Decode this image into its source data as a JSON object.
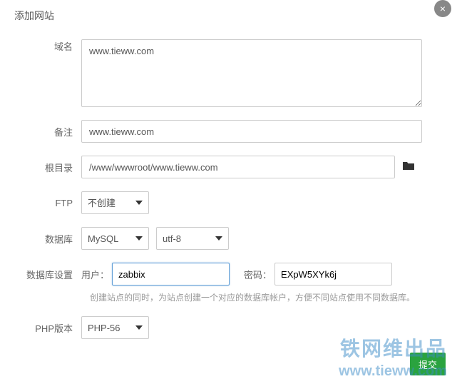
{
  "dialog": {
    "title": "添加网站"
  },
  "form": {
    "domain": {
      "label": "域名",
      "value": "www.tieww.com"
    },
    "remark": {
      "label": "备注",
      "value": "www.tieww.com"
    },
    "root": {
      "label": "根目录",
      "value": "/www/wwwroot/www.tieww.com"
    },
    "ftp": {
      "label": "FTP",
      "selected": "不创建"
    },
    "db": {
      "label": "数据库",
      "selected_engine": "MySQL",
      "selected_charset": "utf-8"
    },
    "db_set": {
      "label": "数据库设置",
      "user_label": "用户：",
      "user_value": "zabbix",
      "pwd_label": "密码：",
      "pwd_value": "EXpW5XYk6j",
      "help": "创建站点的同时，为站点创建一个对应的数据库帐户，方便不同站点使用不同数据库。"
    },
    "php": {
      "label": "PHP版本",
      "selected": "PHP-56"
    }
  },
  "actions": {
    "submit": "提交"
  },
  "watermark": {
    "line1": "铁网维出品",
    "line2": "www.tieww.com"
  }
}
